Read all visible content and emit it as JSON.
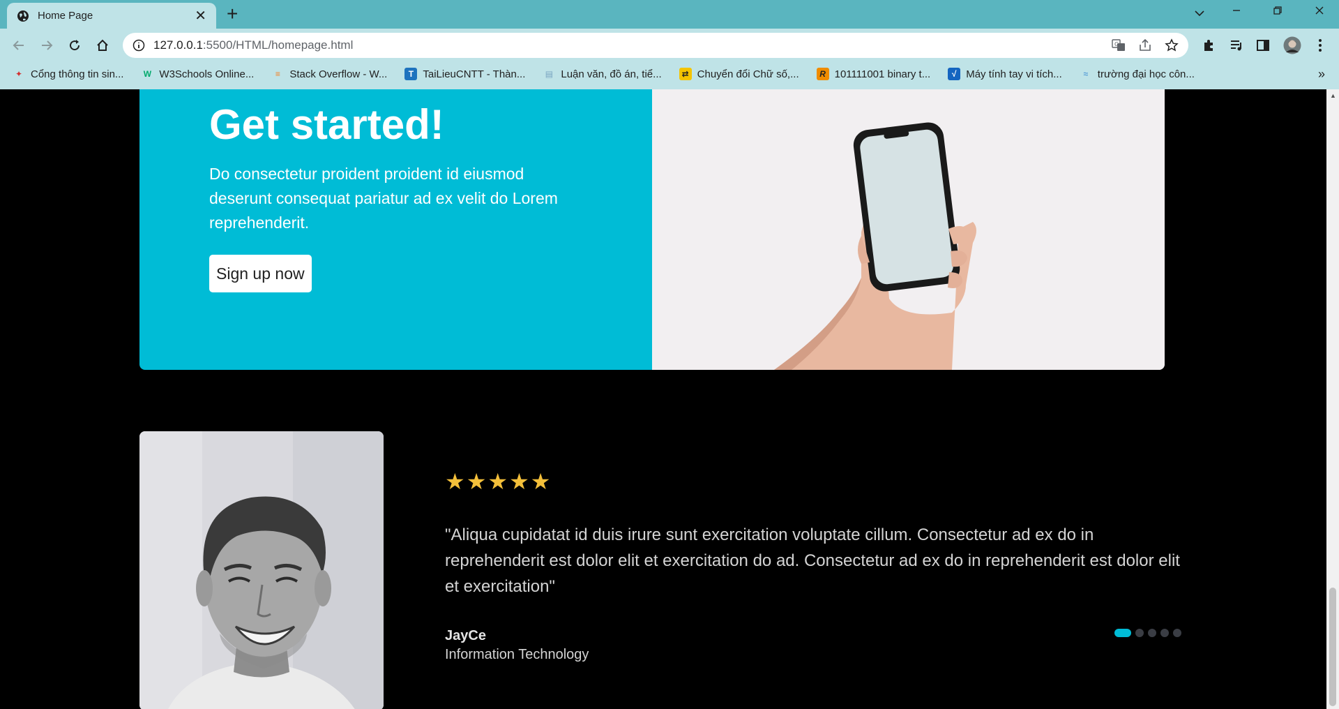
{
  "browser": {
    "tab": {
      "title": "Home Page"
    },
    "address": {
      "host": "127.0.0.1",
      "path": ":5500/HTML/homepage.html"
    },
    "bookmarks": [
      {
        "label": "Cổng thông tin sin...",
        "icon": "vnu-logo-icon",
        "color": "#d32f2f"
      },
      {
        "label": "W3Schools Online...",
        "icon": "w3schools-icon",
        "color": "#04aa6d"
      },
      {
        "label": "Stack Overflow - W...",
        "icon": "stackoverflow-icon",
        "color": "#f48024"
      },
      {
        "label": "TaiLieuCNTT - Thàn...",
        "icon": "tailieucntt-icon",
        "color": "#1e73be"
      },
      {
        "label": "Luận văn, đồ án, tiể...",
        "icon": "luanvan-icon",
        "color": "#7aa6c2"
      },
      {
        "label": "Chuyển đổi Chữ số,...",
        "icon": "converter-icon",
        "color": "#f5c400"
      },
      {
        "label": "101111001 binary t...",
        "icon": "rapidtables-icon",
        "color": "#f08c00"
      },
      {
        "label": "Máy tính tay vi tích...",
        "icon": "calculator-icon",
        "color": "#1565c0"
      },
      {
        "label": "trường đại học côn...",
        "icon": "university-icon",
        "color": "#5aa0d8"
      }
    ]
  },
  "cta": {
    "title": "Get started!",
    "text": "Do consectetur proident proident id eiusmod deserunt consequat pariatur ad ex velit do Lorem reprehenderit.",
    "button": "Sign up now",
    "accent": "#00bcd6"
  },
  "testimonial": {
    "rating": 5,
    "quote": "\"Aliqua cupidatat id duis irure sunt exercitation voluptate cillum. Consectetur ad ex do in reprehenderit est dolor elit et exercitation do ad. Consectetur ad ex do in reprehenderit est dolor elit et exercitation\"",
    "author": "JayCe",
    "role": "Information Technology",
    "slides": 5,
    "active_slide": 1,
    "star_color": "#f3bf3a"
  }
}
